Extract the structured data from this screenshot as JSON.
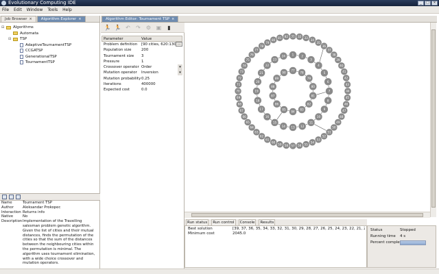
{
  "window": {
    "title": "Evolutionary Computing IDE",
    "buttons": [
      "_",
      "□",
      "×"
    ]
  },
  "menu": [
    "File",
    "Edit",
    "Window",
    "Tools",
    "Help"
  ],
  "left_tabs": [
    {
      "label": "Job Browser",
      "active": false
    },
    {
      "label": "Algorithm Explorer",
      "active": true
    }
  ],
  "tree": [
    {
      "label": "Algorithms",
      "level": 0,
      "type": "folder",
      "expanded": true
    },
    {
      "label": "Automata",
      "level": 1,
      "type": "folder",
      "expanded": false
    },
    {
      "label": "TSP",
      "level": 1,
      "type": "folder",
      "expanded": true
    },
    {
      "label": "AdaptiveTournamentTSP",
      "level": 2,
      "type": "doc"
    },
    {
      "label": "CCGATSP",
      "level": 2,
      "type": "doc"
    },
    {
      "label": "GenerationalTSP",
      "level": 2,
      "type": "doc"
    },
    {
      "label": "TournamentTSP",
      "level": 2,
      "type": "doc"
    }
  ],
  "properties": [
    {
      "key": "Name",
      "value": "Tournament TSP"
    },
    {
      "key": "Author",
      "value": "Aleksandar Prokopec"
    },
    {
      "key": "Interaction",
      "value": "Returns info"
    },
    {
      "key": "Native",
      "value": "No"
    },
    {
      "key": "Description",
      "value": "Implementation of the Travelling salesman problem genetic algorithm. Given the list of cities and their mutual distances, finds the permutation of the cities so that the sum of the distances between the neighbouring cities within the permutation is minimal. The algorithm uses tournament elimination, with a wide choice crossover and mutation operators."
    }
  ],
  "editor_tab": {
    "label": "Algorithm Editor: Tournament TSP"
  },
  "toolbar": [
    "run",
    "run-step",
    "undo",
    "redo",
    "settings",
    "save",
    "info"
  ],
  "param_header": {
    "parameter": "Parameter",
    "value": "Value"
  },
  "params": [
    {
      "name": "Problem definition",
      "value": "[90 cities, 620:130...",
      "widget": "button",
      "button_label": "..."
    },
    {
      "name": "Population size",
      "value": "200",
      "widget": "text"
    },
    {
      "name": "Tournament size",
      "value": "3",
      "widget": "text"
    },
    {
      "name": "Pressure",
      "value": "1",
      "widget": "text"
    },
    {
      "name": "Crossover operator",
      "value": "Order",
      "widget": "select"
    },
    {
      "name": "Mutation operator",
      "value": "Inversion",
      "widget": "select"
    },
    {
      "name": "Mutation probability",
      "value": "0.25",
      "widget": "text"
    },
    {
      "name": "Iterations",
      "value": "400000",
      "widget": "text"
    },
    {
      "name": "Expected cost",
      "value": "0.0",
      "widget": "text"
    }
  ],
  "bottom_tabs": [
    "Run status",
    "Run control",
    "Console",
    "Results"
  ],
  "results": [
    {
      "key": "Best solution",
      "value": "[39, 37, 36, 35, 34, 33, 32, 31, 30, 29, 28, 27, 26, 25, 24, 23, 22, 21, 20, 19..."
    },
    {
      "key": "Minimum cost",
      "value": "2045.0"
    }
  ],
  "status": {
    "status_label": "Status",
    "status_value": "Stopped",
    "time_label": "Running time",
    "time_value": "4 s",
    "percent_label": "Percent complete",
    "percent_fraction": 1.0
  },
  "graph": {
    "rings": [
      {
        "count": 52,
        "start": 31
      },
      {
        "count": 24,
        "start": 1
      },
      {
        "count": 14,
        "start": 77
      }
    ],
    "node_fill": "#8a8a8a",
    "node_text": "#ffffff"
  },
  "colors": {
    "accent": "#6f8cb0",
    "titlebar": "#1e2f4e"
  }
}
